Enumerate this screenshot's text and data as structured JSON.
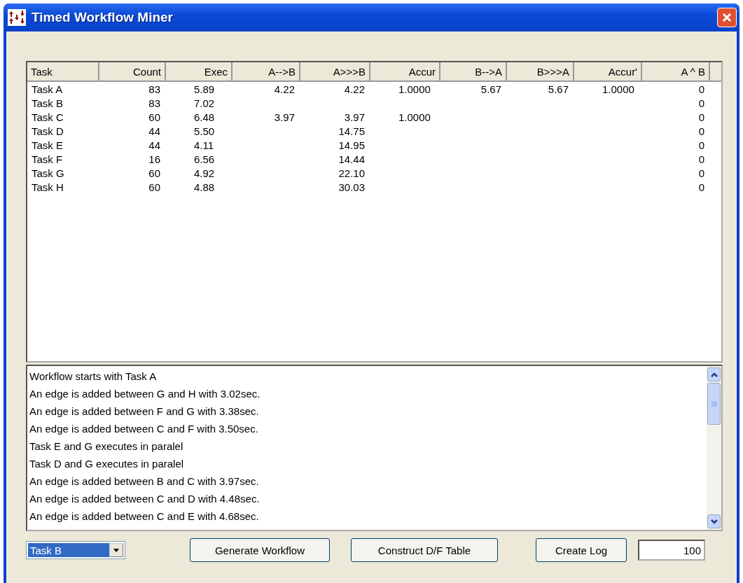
{
  "window": {
    "title": "Timed Workflow Miner"
  },
  "table": {
    "columns": [
      "Task",
      "Count",
      "Exec",
      "A-->B",
      "A>>>B",
      "Accur",
      "B-->A",
      "B>>>A",
      "Accur'",
      "A ^ B"
    ],
    "rows": [
      [
        "Task A",
        "83",
        "5.89",
        "4.22",
        "4.22",
        "1.0000",
        "5.67",
        "5.67",
        "1.0000",
        "0"
      ],
      [
        "Task B",
        "83",
        "7.02",
        "",
        "",
        "",
        "",
        "",
        "",
        "0"
      ],
      [
        "Task C",
        "60",
        "6.48",
        "3.97",
        "3.97",
        "1.0000",
        "",
        "",
        "",
        "0"
      ],
      [
        "Task D",
        "44",
        "5.50",
        "",
        "14.75",
        "",
        "",
        "",
        "",
        "0"
      ],
      [
        "Task E",
        "44",
        "4.11",
        "",
        "14.95",
        "",
        "",
        "",
        "",
        "0"
      ],
      [
        "Task F",
        "16",
        "6.56",
        "",
        "14.44",
        "",
        "",
        "",
        "",
        "0"
      ],
      [
        "Task G",
        "60",
        "4.92",
        "",
        "22.10",
        "",
        "",
        "",
        "",
        "0"
      ],
      [
        "Task H",
        "60",
        "4.88",
        "",
        "30.03",
        "",
        "",
        "",
        "",
        "0"
      ]
    ]
  },
  "log": [
    "Workflow starts with Task A",
    "An edge is added between G and H with 3.02sec.",
    "An edge is added between F and G with 3.38sec.",
    "An edge is added between C and F with 3.50sec.",
    "Task E and G executes in paralel",
    "Task D and G executes in paralel",
    "An edge is added between B and C with 3.97sec.",
    "An edge is added between C and D with 4.48sec.",
    "An edge is added between C and E with 4.68sec."
  ],
  "task_select": {
    "value": "Task B"
  },
  "buttons": [
    "Generate Workflow",
    "Construct D/F Table",
    "Create Log"
  ],
  "count_field": {
    "value": "100"
  }
}
